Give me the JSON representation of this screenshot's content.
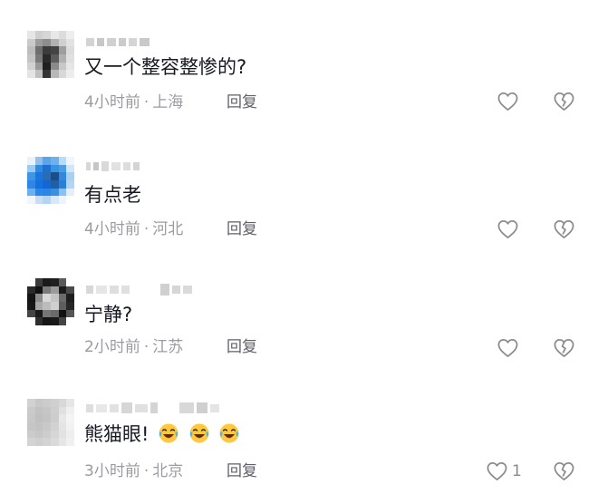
{
  "comments": [
    {
      "text": "又一个整容整惨的?",
      "time": "4小时前",
      "location": "上海",
      "reply_label": "回复",
      "like_count": "",
      "emoji": []
    },
    {
      "text": "有点老",
      "time": "4小时前",
      "location": "河北",
      "reply_label": "回复",
      "like_count": "",
      "emoji": []
    },
    {
      "text": "宁静?",
      "time": "2小时前",
      "location": "江苏",
      "reply_label": "回复",
      "like_count": "",
      "emoji": []
    },
    {
      "text": "熊猫眼!",
      "time": "3小时前",
      "location": "北京",
      "reply_label": "回复",
      "like_count": "1",
      "emoji": [
        "laughing-tears",
        "laughing-tears",
        "laughing-tears"
      ]
    }
  ],
  "separator": "·",
  "icons": {
    "like": "heart-outline-icon",
    "dislike": "broken-heart-outline-icon"
  },
  "colors": {
    "meta": "#9b9ba1",
    "text": "#161823",
    "icon": "#8a8b91"
  }
}
